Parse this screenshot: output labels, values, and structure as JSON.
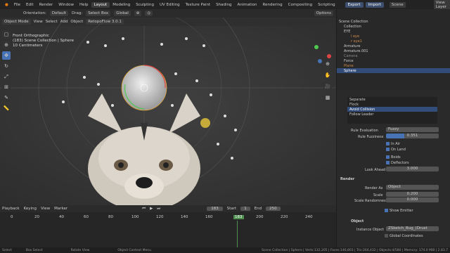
{
  "menu": [
    "File",
    "Edit",
    "Render",
    "Window",
    "Help"
  ],
  "workspaces": [
    "Layout",
    "Modeling",
    "Sculpting",
    "UV Editing",
    "Texture Paint",
    "Shading",
    "Animation",
    "Rendering",
    "Compositing",
    "Scripting"
  ],
  "top_right": {
    "export": "Export",
    "import": "Import",
    "scene": "Scene",
    "view_layer": "View Layer"
  },
  "header": {
    "orientation_label": "Orientation:",
    "orientation": "Default",
    "drag_label": "Drag:",
    "drag": "Select Box",
    "pivot": "Global",
    "options": "Options",
    "retopo": "RetopoFlow 3.0.1"
  },
  "header2": {
    "mode": "Object Mode",
    "view": "View",
    "select": "Select",
    "add": "Add",
    "object": "Object"
  },
  "viewport": {
    "line1": "Front Orthographic",
    "line2": "(183) Scene Collection | Sphere",
    "line3": "10 Centimeters"
  },
  "timeline": {
    "playback": "Playback",
    "keying": "Keying",
    "view": "View",
    "marker": "Marker",
    "frame": "183",
    "start_label": "Start",
    "start": "1",
    "end_label": "End",
    "end": "250",
    "ticks": [
      "0",
      "20",
      "40",
      "60",
      "80",
      "100",
      "120",
      "140",
      "160",
      "183",
      "200",
      "220",
      "240"
    ]
  },
  "status": {
    "select": "Select",
    "box_select": "Box Select",
    "rotate": "Rotate View",
    "context": "Object Context Menu",
    "info": "Scene Collection | Sphere | Verts:132,205 | Faces:146,803 | Tris:264,432 | Objects:4/580 | Memory: 174.0 MiB | 2.83.7"
  },
  "outliner": {
    "title": "Scene Collection",
    "items": [
      {
        "label": "Collection",
        "indent": 1
      },
      {
        "label": "EYE",
        "indent": 1
      },
      {
        "label": "l eye",
        "indent": 2
      },
      {
        "label": "r eye1",
        "indent": 2
      },
      {
        "label": "Armature",
        "indent": 1
      },
      {
        "label": "Armature.001",
        "indent": 1
      },
      {
        "label": "Camera",
        "indent": 1
      },
      {
        "label": "Force",
        "indent": 1
      },
      {
        "label": "Plane",
        "indent": 1
      },
      {
        "label": "Sphere",
        "indent": 1
      }
    ]
  },
  "props": {
    "rules": [
      "Separate",
      "Flock",
      "Avoid Collision",
      "Follow Leader"
    ],
    "rule_eval_label": "Rule Evaluation",
    "rule_eval": "Fuzzy",
    "fuzz_label": "Rule Fuzziness",
    "fuzz": "0.351",
    "in_air": "In Air",
    "on_land": "On Land",
    "boids": "Boids",
    "deflectors": "Deflectors",
    "look_ahead_label": "Look Ahead",
    "look_ahead": "3.000",
    "render_title": "Render",
    "render_as_label": "Render As",
    "render_as": "Object",
    "scale_label": "Scale",
    "scale": "0.200",
    "scale_rand_label": "Scale Randomness",
    "scale_rand": "0.000",
    "show_emitter": "Show Emitter",
    "object_title": "Object",
    "instance_label": "Instance Object",
    "instance": "ZSketch_Bug_(Drust",
    "global_coords": "Global Coordinates"
  },
  "colors": {
    "accent": "#4772b3",
    "active_row": "#334d7a",
    "viewport_bg": "#3a3a3a",
    "playhead": "#4f8f4f"
  }
}
